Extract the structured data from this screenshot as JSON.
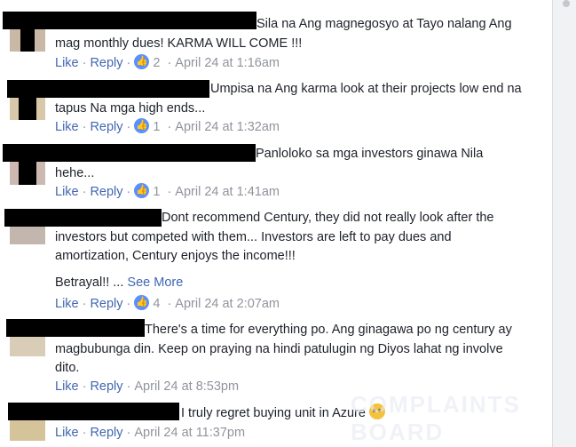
{
  "comments": [
    {
      "text_first": "Sila na Ang magnegosyo at Tayo nalang Ang",
      "text_rest": "mag monthly dues! KARMA WILL COME !!!",
      "like": "Like",
      "reply": "Reply",
      "likes": "2",
      "time": "April 24 at 1:16am"
    },
    {
      "text_first": "Umpisa na Ang karma look at their projects low end na",
      "text_rest": "tapus Na mga high ends...",
      "like": "Like",
      "reply": "Reply",
      "likes": "1",
      "time": "April 24 at 1:32am"
    },
    {
      "text_first": "Panloloko sa mga investors ginawa Nila",
      "text_rest": "hehe...",
      "like": "Like",
      "reply": "Reply",
      "likes": "1",
      "time": "April 24 at 1:41am"
    },
    {
      "text_first": "Dont recommend Century, they did not really look after the",
      "text_line2": "investors but competed with them... Investors are left to pay dues and",
      "text_line3": "amortization, Century enjoys the income!!!",
      "text_line4": "Betrayal!! ...",
      "see_more": "See More",
      "like": "Like",
      "reply": "Reply",
      "likes": "4",
      "time": "April 24 at 2:07am"
    },
    {
      "text_first": "There's a time for everything po. Ang ginagawa po ng century ay",
      "text_line2": "magbubunga din. Keep on praying na hindi patulugin ng Diyos lahat ng involve",
      "text_line3": "dito.",
      "like": "Like",
      "reply": "Reply",
      "time": "April 24 at 8:53pm"
    },
    {
      "text_first": "I truly regret buying unit in Azure",
      "emoji": "crying-face",
      "like": "Like",
      "reply": "Reply",
      "time": "April 24 at 11:37pm"
    }
  ],
  "watermark": "COMPLAINTS BOARD"
}
